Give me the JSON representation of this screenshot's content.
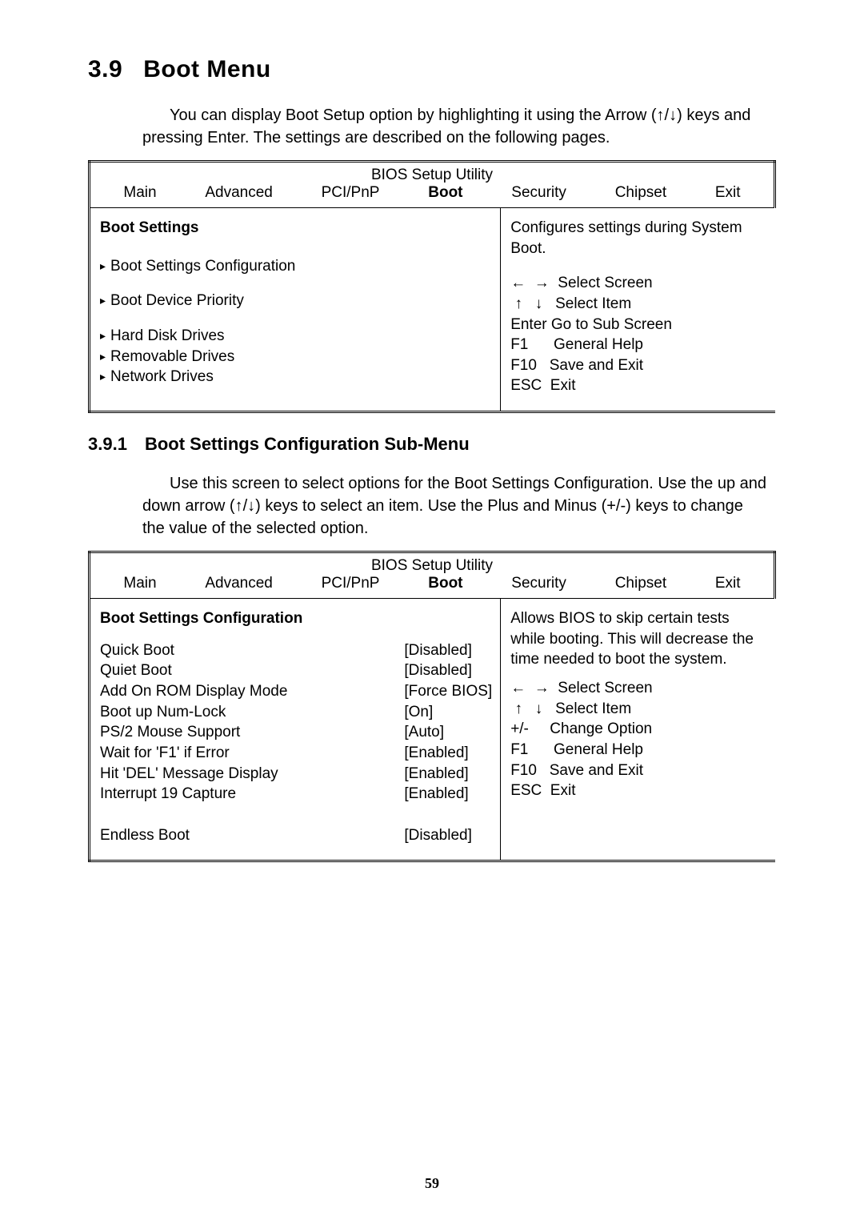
{
  "section": {
    "num": "3.9",
    "title": "Boot Menu",
    "intro": "You can display Boot Setup option by highlighting it using the Arrow (↑/↓) keys and pressing Enter.  The settings are described on the following pages."
  },
  "bios1": {
    "title": "BIOS Setup Utility",
    "tabs": [
      "Main",
      "Advanced",
      "PCI/PnP",
      "Boot",
      "Security",
      "Chipset",
      "Exit"
    ],
    "boldTab": "Boot",
    "left": {
      "heading": "Boot Settings",
      "items_group1": [
        "Boot Settings Configuration",
        "Boot Device Priority"
      ],
      "items_group2": [
        "Hard Disk Drives",
        "Removable Drives",
        "Network Drives"
      ]
    },
    "right": {
      "desc": "Configures settings during System Boot.",
      "hints": "←  →  Select Screen\n ↑   ↓   Select Item\nEnter Go to Sub Screen\nF1      General Help\nF10   Save and Exit\nESC  Exit"
    }
  },
  "subsection": {
    "num": "3.9.1",
    "title": "Boot Settings Configuration Sub-Menu",
    "intro": "Use this screen to select options for the Boot Settings Configuration. Use the up and down arrow (↑/↓) keys to select an item. Use the Plus and Minus (+/-) keys to change the value of the selected option."
  },
  "bios2": {
    "title": "BIOS Setup Utility",
    "tabs": [
      "Main",
      "Advanced",
      "PCI/PnP",
      "Boot",
      "Security",
      "Chipset",
      "Exit"
    ],
    "boldTab": "Boot",
    "left": {
      "heading": "Boot Settings Configuration",
      "rows": [
        {
          "label": "Quick Boot",
          "value": "[Disabled]"
        },
        {
          "label": "Quiet Boot",
          "value": "[Disabled]"
        },
        {
          "label": "Add On ROM Display Mode",
          "value": "[Force BIOS]"
        },
        {
          "label": "Boot up Num-Lock",
          "value": "[On]"
        },
        {
          "label": "PS/2 Mouse Support",
          "value": "[Auto]"
        },
        {
          "label": "Wait for 'F1' if Error",
          "value": "[Enabled]"
        },
        {
          "label": "Hit 'DEL' Message Display",
          "value": "[Enabled]"
        },
        {
          "label": "Interrupt 19 Capture",
          "value": "[Enabled]"
        },
        {
          "label": "",
          "value": ""
        },
        {
          "label": "Endless Boot",
          "value": "[Disabled]"
        }
      ]
    },
    "right": {
      "desc": "Allows BIOS to skip certain tests while booting.  This will decrease the time needed to boot the system.",
      "hints": "←  →  Select Screen\n ↑   ↓   Select Item\n+/-     Change Option\nF1      General Help\nF10   Save and Exit\nESC  Exit"
    }
  },
  "pageNumber": "59"
}
